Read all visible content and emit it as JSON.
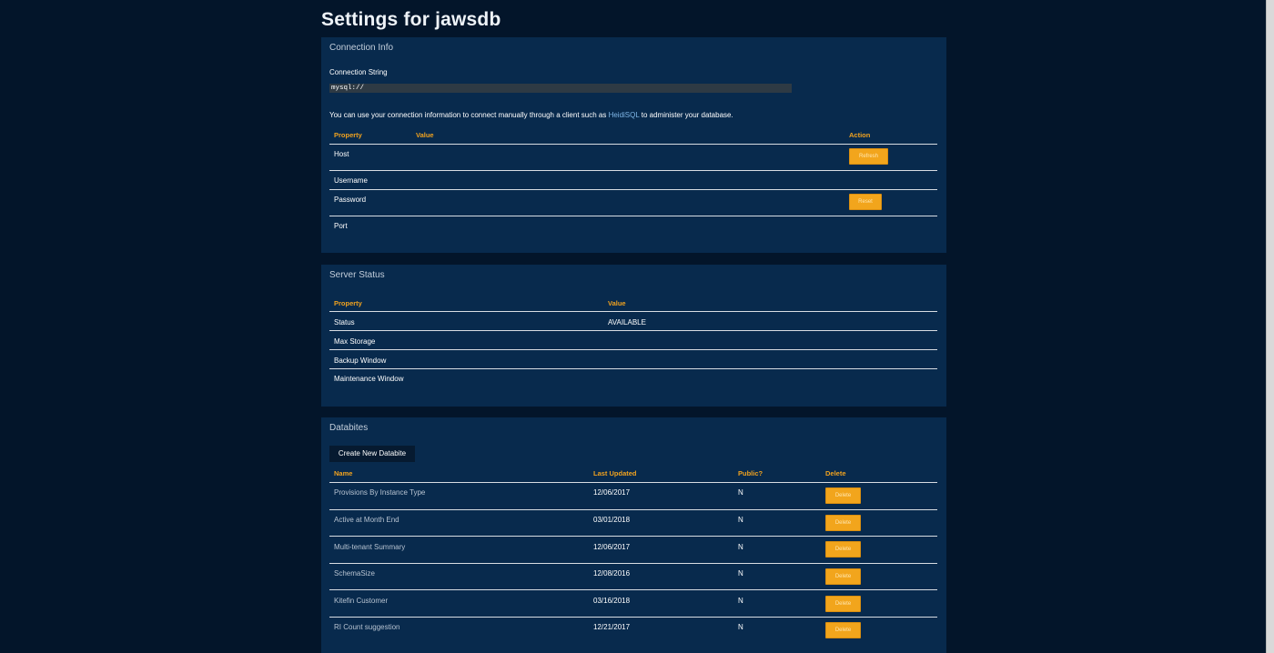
{
  "page": {
    "title": "Settings for jawsdb"
  },
  "connection_info": {
    "title": "Connection Info",
    "conn_string_label": "Connection String",
    "conn_string_value": "mysql://",
    "info_prefix": "You can use your connection information to connect manually through a client such as ",
    "info_link": "HeidiSQL",
    "info_suffix": " to administer your database.",
    "headers": {
      "property": "Property",
      "value": "Value",
      "action": "Action"
    },
    "rows": [
      {
        "property": "Host",
        "value": "",
        "action": "Refresh"
      },
      {
        "property": "Username",
        "value": "",
        "action": ""
      },
      {
        "property": "Password",
        "value": "",
        "action": "Reset"
      },
      {
        "property": "Port",
        "value": "",
        "action": ""
      }
    ]
  },
  "server_status": {
    "title": "Server Status",
    "headers": {
      "property": "Property",
      "value": "Value"
    },
    "rows": [
      {
        "property": "Status",
        "value": "AVAILABLE"
      },
      {
        "property": "Max Storage",
        "value": ""
      },
      {
        "property": "Backup Window",
        "value": ""
      },
      {
        "property": "Maintenance Window",
        "value": ""
      }
    ]
  },
  "databites": {
    "title": "Databites",
    "create_button": "Create New Databite",
    "headers": {
      "name": "Name",
      "last_updated": "Last Updated",
      "public": "Public?",
      "delete": "Delete"
    },
    "rows": [
      {
        "name": "Provisions By Instance Type",
        "last_updated": "12/06/2017",
        "public": "N",
        "delete": "Delete"
      },
      {
        "name": "Active at Month End",
        "last_updated": "03/01/2018",
        "public": "N",
        "delete": "Delete"
      },
      {
        "name": "Multi-tenant Summary",
        "last_updated": "12/06/2017",
        "public": "N",
        "delete": "Delete"
      },
      {
        "name": "SchemaSize",
        "last_updated": "12/08/2016",
        "public": "N",
        "delete": "Delete"
      },
      {
        "name": "Kitefin Customer",
        "last_updated": "03/16/2018",
        "public": "N",
        "delete": "Delete"
      },
      {
        "name": "RI Count suggestion",
        "last_updated": "12/21/2017",
        "public": "N",
        "delete": "Delete"
      }
    ]
  }
}
